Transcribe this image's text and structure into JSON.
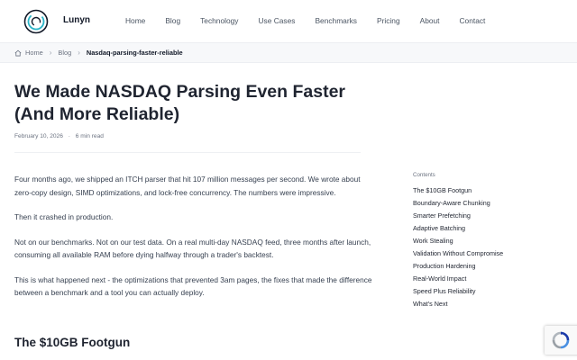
{
  "header": {
    "brand": "Lunyn",
    "nav": [
      "Home",
      "Blog",
      "Technology",
      "Use Cases",
      "Benchmarks",
      "Pricing",
      "About",
      "Contact"
    ]
  },
  "breadcrumb": {
    "home": "Home",
    "blog": "Blog",
    "current": "Nasdaq-parsing-faster-reliable"
  },
  "article": {
    "title": "We Made NASDAQ Parsing Even Faster (And More Reliable)",
    "date": "February 10, 2026",
    "read_time": "6 min read",
    "paragraphs": [
      "Four months ago, we shipped an ITCH parser that hit 107 million messages per second. We wrote about zero-copy design, SIMD optimizations, and lock-free concurrency. The numbers were impressive.",
      "Then it crashed in production.",
      "Not on our benchmarks. Not on our test data. On a real multi-day NASDAQ feed, three months after launch, consuming all available RAM before dying halfway through a trader's backtest.",
      "This is what happened next - the optimizations that prevented 3am pages, the fixes that made the difference between a benchmark and a tool you can actually deploy."
    ],
    "section_heading": "The $10GB Footgun"
  },
  "toc": {
    "title": "Contents",
    "items": [
      "The $10GB Footgun",
      "Boundary-Aware Chunking",
      "Smarter Prefetching",
      "Adaptive Batching",
      "Work Stealing",
      "Validation Without Compromise",
      "Production Hardening",
      "Real-World Impact",
      "Speed Plus Reliability",
      "What's Next"
    ]
  },
  "colors": {
    "brand_ring": "#2bb5c8",
    "text": "#1f2430",
    "muted": "#6b7280"
  }
}
